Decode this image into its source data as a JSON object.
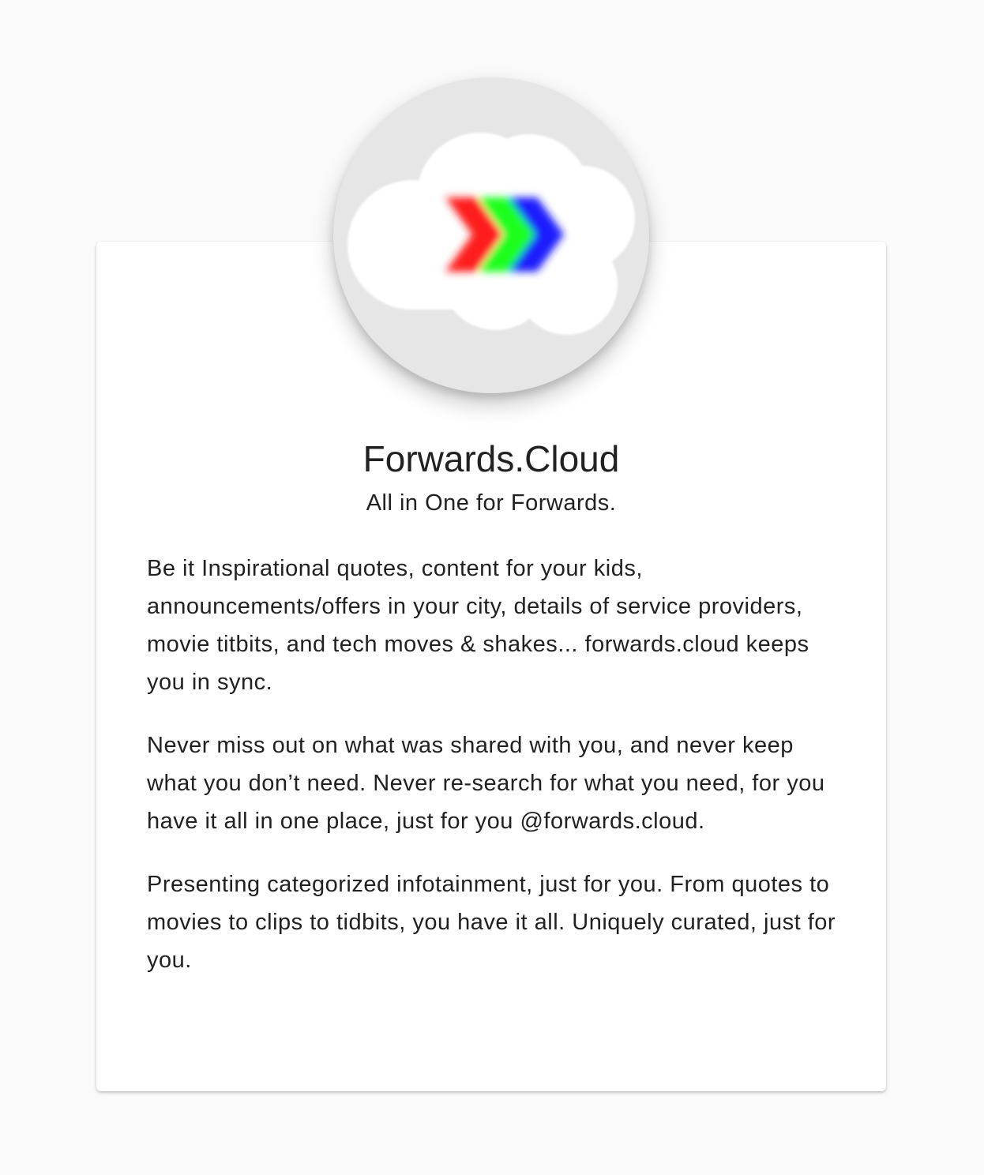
{
  "app": {
    "title": "Forwards.Cloud",
    "tagline": "All in One for Forwards."
  },
  "logo": {
    "icon": "cloud-forward-arrows-icon",
    "colors": {
      "circle_bg": "#e6e6e6",
      "cloud": "#ffffff",
      "chevron_red": "#ff1a1a",
      "chevron_green": "#1aff1a",
      "chevron_blue": "#1a1aff"
    }
  },
  "description": {
    "paragraphs": [
      "Be it Inspirational quotes, content for your kids, announcements/offers in your city, details of service providers, movie titbits, and tech moves & shakes... forwards.cloud keeps you in sync.",
      "Never miss out on what was shared with you, and never keep what you don’t need. Never re-search for what you need, for you have it all in one place, just for you @forwards.cloud.",
      "Presenting categorized infotainment, just for you. From quotes to movies to clips to tidbits, you have it all. Uniquely curated, just for you."
    ]
  }
}
